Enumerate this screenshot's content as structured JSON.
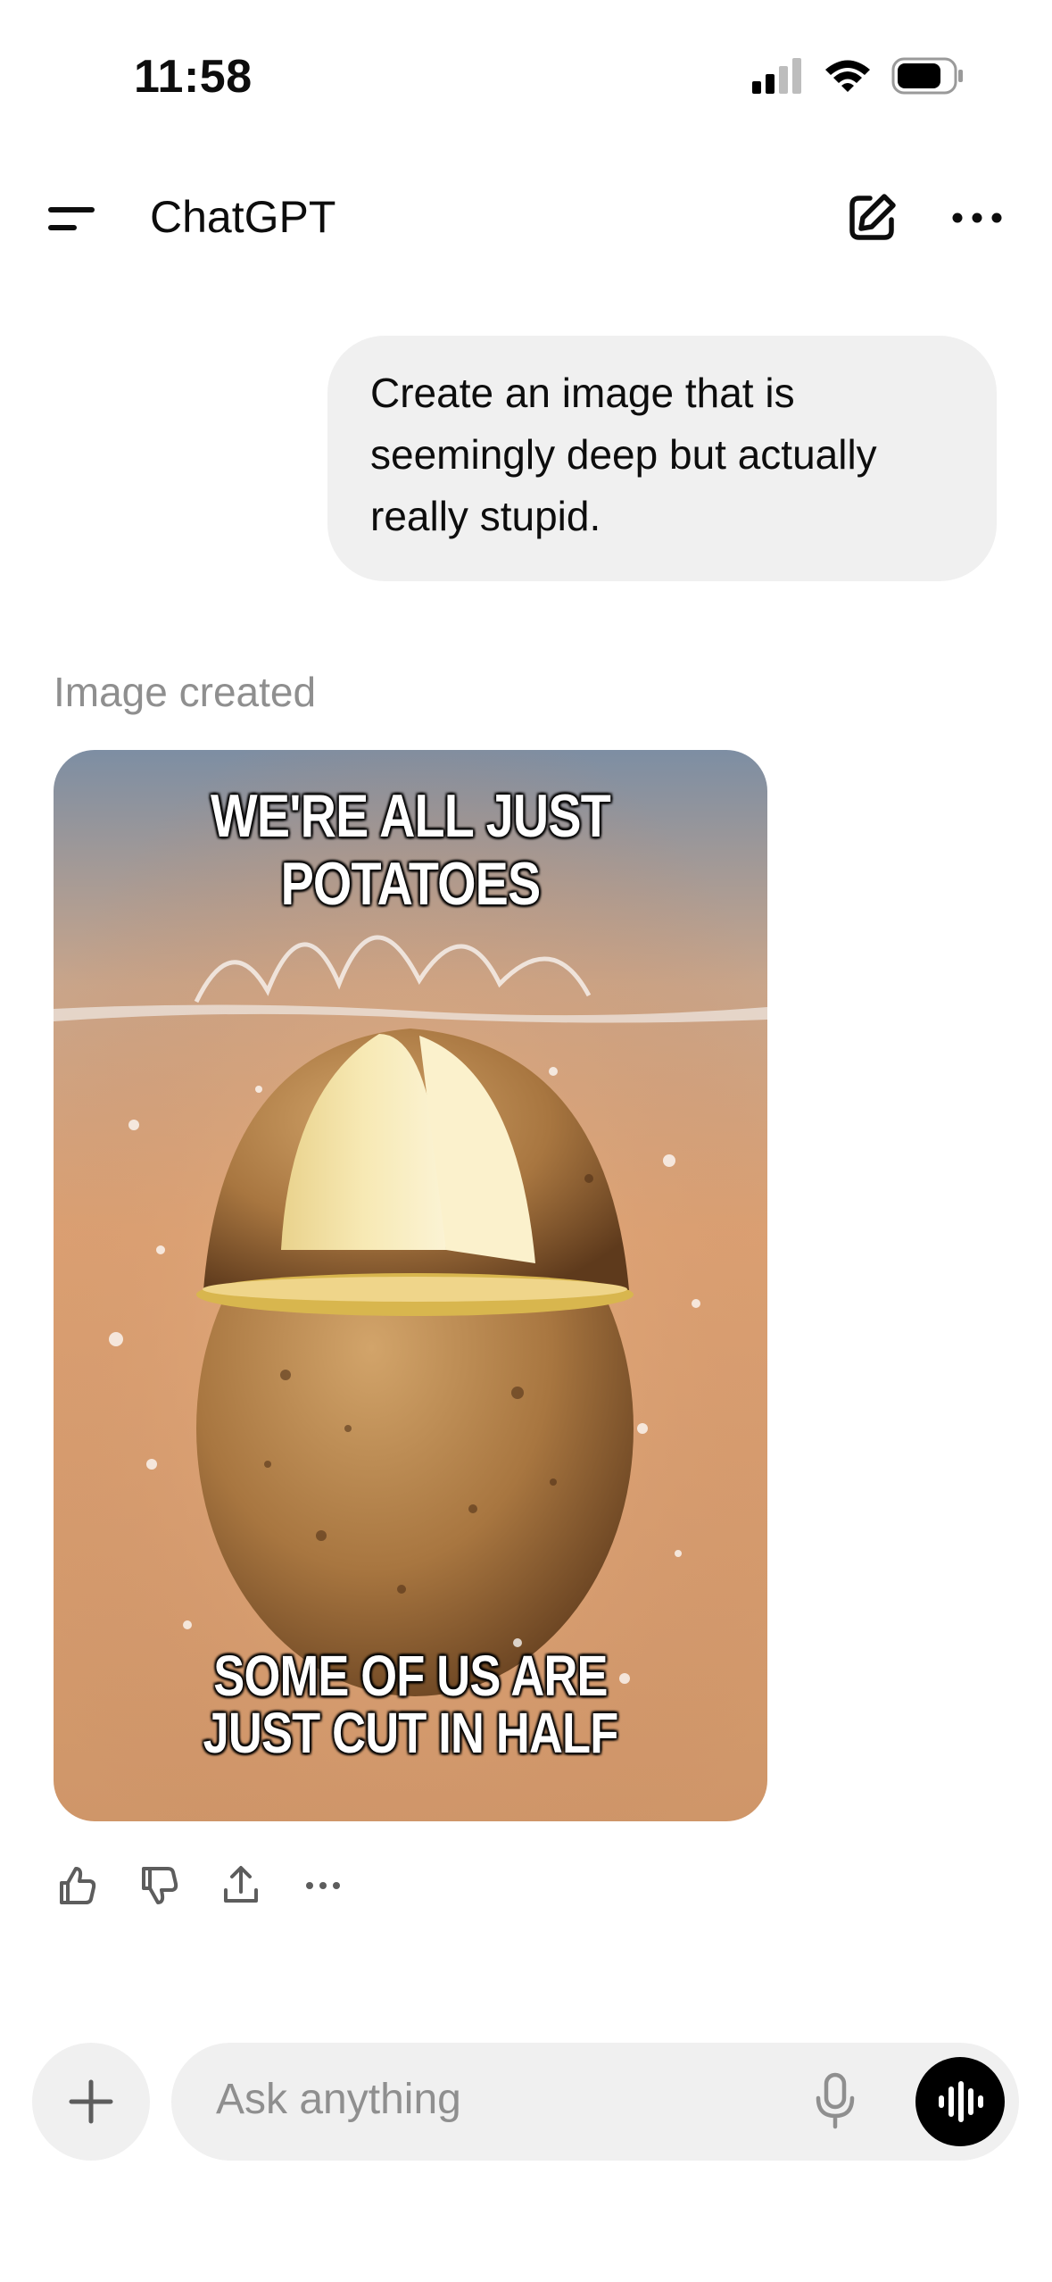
{
  "status_bar": {
    "time": "11:58"
  },
  "header": {
    "title": "ChatGPT"
  },
  "conversation": {
    "user_message": "Create an image that is seemingly deep but actually really stupid.",
    "assistant_label": "Image created",
    "image": {
      "top_caption": "WE'RE ALL JUST POTATOES",
      "bottom_caption": "SOME OF US ARE\nJUST CUT IN HALF"
    }
  },
  "composer": {
    "placeholder": "Ask anything"
  },
  "colors": {
    "bubble": "#f0f0f0",
    "muted_text": "#8f8f8f",
    "voice_button": "#000000"
  }
}
